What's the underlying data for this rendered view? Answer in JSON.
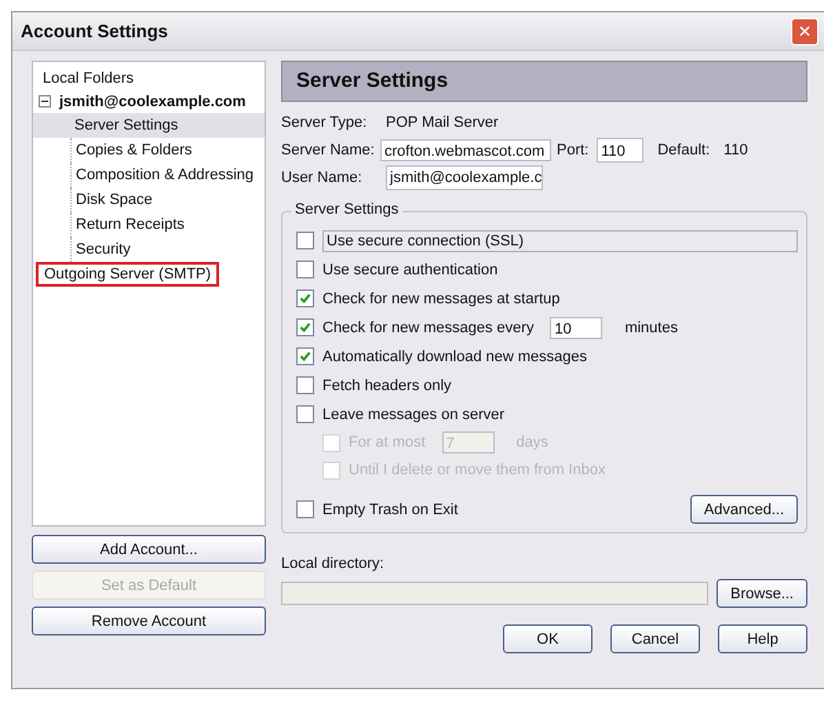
{
  "window": {
    "title": "Account Settings",
    "close": "✕"
  },
  "tree": [
    {
      "label": "Local Folders",
      "bold": false,
      "selected": false,
      "highlighted": false
    },
    {
      "label": "jsmith@coolexample.com",
      "bold": true,
      "expanded": true,
      "selected": false,
      "highlighted": false,
      "children": [
        {
          "label": "Server Settings",
          "selected": true
        },
        {
          "label": "Copies & Folders",
          "selected": false
        },
        {
          "label": "Composition & Addressing",
          "selected": false
        },
        {
          "label": "Disk Space",
          "selected": false
        },
        {
          "label": "Return Receipts",
          "selected": false
        },
        {
          "label": "Security",
          "selected": false
        }
      ]
    },
    {
      "label": "Outgoing Server (SMTP)",
      "bold": false,
      "selected": false,
      "highlighted": true
    }
  ],
  "account_buttons": [
    {
      "label": "Add Account...",
      "disabled": false
    },
    {
      "label": "Set as Default",
      "disabled": true
    },
    {
      "label": "Remove Account",
      "disabled": false
    }
  ],
  "panel": {
    "title": "Server Settings",
    "server_type": {
      "label": "Server Type:",
      "value": "POP Mail Server"
    },
    "server_name": {
      "label": "Server Name:",
      "value": "crofton.webmascot.com"
    },
    "port": {
      "label": "Port:",
      "value": "110"
    },
    "default": {
      "label": "Default:",
      "value": "110"
    },
    "user_name": {
      "label": "User Name:",
      "value": "jsmith@coolexample.c"
    },
    "group_title": "Server Settings",
    "options": [
      {
        "kind": "check",
        "label": "Use secure connection (SSL)",
        "checked": false,
        "disabled": false,
        "focused": true
      },
      {
        "kind": "check",
        "label": "Use secure authentication",
        "checked": false,
        "disabled": false,
        "focused": false
      },
      {
        "kind": "check",
        "label": "Check for new messages at startup",
        "checked": true,
        "disabled": false,
        "focused": false
      },
      {
        "kind": "interval",
        "label": "Check for new messages every",
        "value": "10",
        "unit": "minutes",
        "checked": true,
        "disabled": false,
        "focused": false
      },
      {
        "kind": "check",
        "label": "Automatically download new messages",
        "checked": true,
        "disabled": false,
        "focused": false
      },
      {
        "kind": "check",
        "label": "Fetch headers only",
        "checked": false,
        "disabled": false,
        "focused": false
      },
      {
        "kind": "check",
        "label": "Leave messages on server",
        "checked": false,
        "disabled": false,
        "focused": false,
        "children": [
          {
            "kind": "interval",
            "label": "For at most",
            "value": "7",
            "unit": "days",
            "checked": false,
            "disabled": true
          },
          {
            "kind": "check",
            "label": "Until I delete or move them from Inbox",
            "checked": false,
            "disabled": true
          }
        ]
      }
    ],
    "empty_trash": {
      "label": "Empty Trash on Exit",
      "checked": false
    },
    "advanced": "Advanced...",
    "local_directory": {
      "label": "Local directory:",
      "browse": "Browse..."
    }
  },
  "dialog_buttons": [
    "OK",
    "Cancel",
    "Help"
  ]
}
